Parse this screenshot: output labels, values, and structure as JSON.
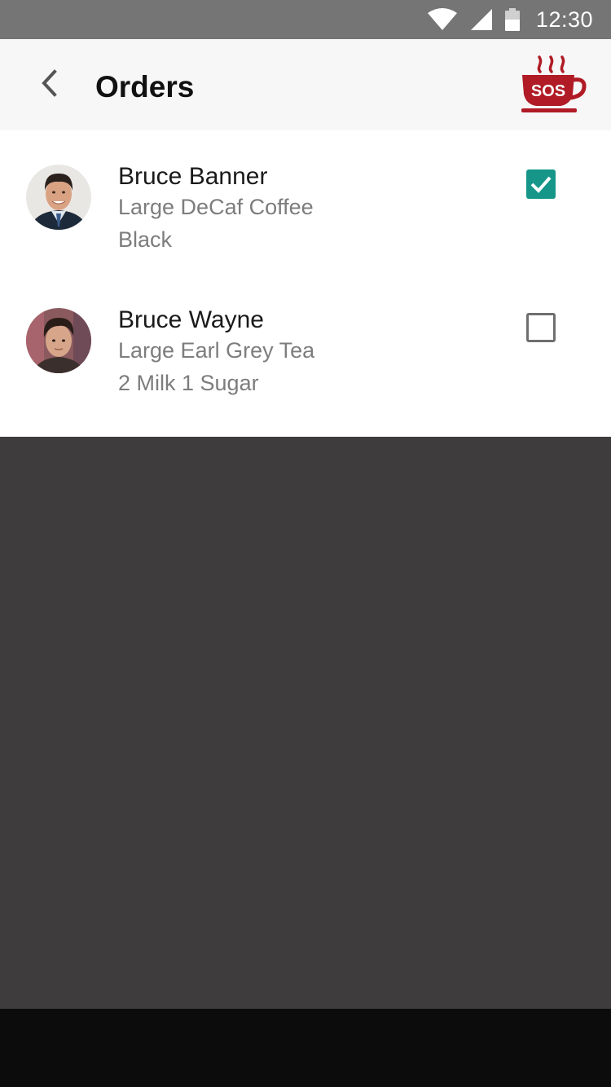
{
  "status_bar": {
    "time": "12:30",
    "icons": [
      "wifi-icon",
      "cell-signal-icon",
      "battery-icon"
    ]
  },
  "app_bar": {
    "title": "Orders",
    "back_icon": "chevron-left-icon",
    "logo": {
      "text": "SOS",
      "color": "#b01b25"
    }
  },
  "orders": [
    {
      "name": "Bruce Banner",
      "item": "Large DeCaf Coffee",
      "note": "Black",
      "checked": true
    },
    {
      "name": "Bruce Wayne",
      "item": "Large Earl Grey Tea",
      "note": "2 Milk 1 Sugar",
      "checked": false
    }
  ],
  "colors": {
    "accent": "#159688",
    "app_bar_bg": "#f7f7f7",
    "background_dark": "#3e3c3d",
    "status_bar": "#757575",
    "nav_bar": "#0c0c0c",
    "brand_red": "#b01b25"
  }
}
